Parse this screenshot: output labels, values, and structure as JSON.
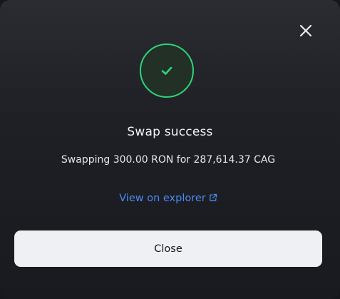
{
  "modal": {
    "title": "Swap success",
    "message": "Swapping 300.00 RON for 287,614.37 CAG",
    "explorer_link_label": "View on explorer",
    "close_button_label": "Close",
    "icons": {
      "close": "close-icon",
      "success": "check-icon",
      "external": "external-link-icon"
    }
  },
  "colors": {
    "success": "#2ed47a",
    "link": "#4a8cf0",
    "button_bg": "#eef0f4"
  }
}
